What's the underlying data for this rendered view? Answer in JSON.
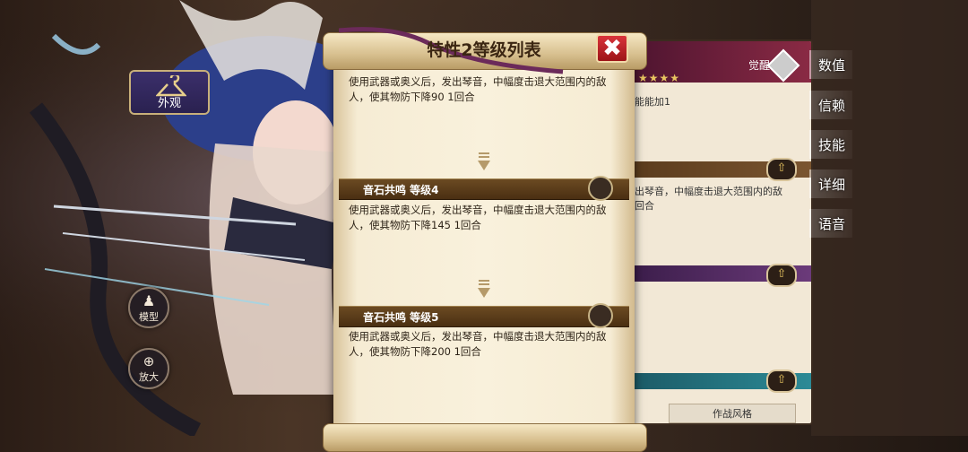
{
  "popup": {
    "title": "特性2等级列表",
    "close_symbol": "✖",
    "entries": [
      {
        "desc": "使用武器或奥义后，发出琴音，中幅度击退大范围内的敌人，使其物防下降90 1回合"
      },
      {
        "level_label": "音石共鸣 等级4",
        "desc": "使用武器或奥义后，发出琴音，中幅度击退大范围内的敌人，使其物防下降145 1回合"
      },
      {
        "level_label": "音石共鸣 等级5",
        "desc": "使用武器或奥义后，发出琴音，中幅度击退大范围内的敌人，使其物防下降200 1回合"
      }
    ]
  },
  "left_controls": {
    "outfit_label": "外观",
    "model_label": "模型",
    "zoom_label": "放大"
  },
  "right_panel": {
    "awaken_label": "觉醒",
    "stars": "★★★★",
    "partial_text_1": "能能加1",
    "partial_text_2a": "出琴音，中幅度击退大范围内的敌",
    "partial_text_2b": "回合",
    "footer_label": "作战风格"
  },
  "tabs": [
    "数值",
    "信赖",
    "技能",
    "详细",
    "语音"
  ],
  "colors": {
    "scroll": "#f9f1dc",
    "level_bar": "#5a3b18",
    "close": "#c8262c",
    "panel_header": "#6b1f3a"
  }
}
